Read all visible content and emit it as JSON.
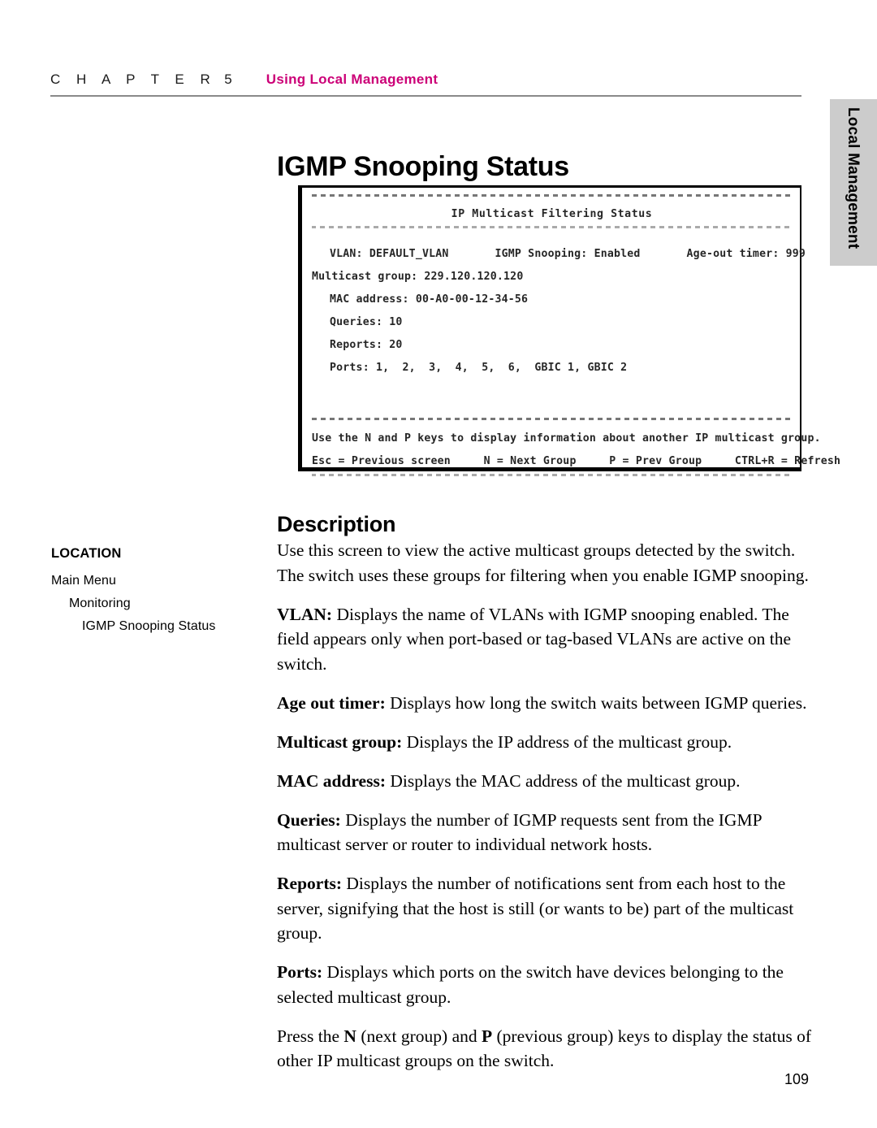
{
  "header": {
    "chapter_word": "C H A P T E R",
    "chapter_number": "5",
    "chapter_title": "Using Local Management",
    "accent_color": "#cc0077"
  },
  "side_tab": {
    "label": "Local Management",
    "background_color": "#cccccc"
  },
  "page_title": "IGMP Snooping Status",
  "terminal": {
    "title": "IP Multicast Filtering Status",
    "lines": [
      "VLAN: DEFAULT_VLAN       IGMP Snooping: Enabled       Age-out timer: 999",
      "Multicast group: 229.120.120.120",
      "MAC address: 00-A0-00-12-34-56",
      "Queries: 10",
      "Reports: 20",
      "Ports: 1,  2,  3,  4,  5,  6,  GBIC 1, GBIC 2"
    ],
    "help_line": "Use the N and P keys to display information about another IP multicast group.",
    "key_line": "Esc = Previous screen     N = Next Group     P = Prev Group     CTRL+R = Refresh",
    "fields": {
      "vlan_label": "VLAN:",
      "vlan_value": "DEFAULT_VLAN",
      "igmp_snooping_label": "IGMP Snooping:",
      "igmp_snooping_value": "Enabled",
      "age_out_timer_label": "Age-out timer:",
      "age_out_timer_value": "999",
      "multicast_group_label": "Multicast group:",
      "multicast_group_value": "229.120.120.120",
      "mac_address_label": "MAC address:",
      "mac_address_value": "00-A0-00-12-34-56",
      "queries_label": "Queries:",
      "queries_value": "10",
      "reports_label": "Reports:",
      "reports_value": "20",
      "ports_label": "Ports:",
      "ports_value": "1,  2,  3,  4,  5,  6,  GBIC 1, GBIC 2"
    },
    "keys": [
      {
        "key": "Esc",
        "action": "Previous screen"
      },
      {
        "key": "N",
        "action": "Next Group"
      },
      {
        "key": "P",
        "action": "Prev Group"
      },
      {
        "key": "CTRL+R",
        "action": "Refresh"
      }
    ]
  },
  "description_heading": "Description",
  "location": {
    "title": "LOCATION",
    "items": [
      {
        "label": "Main Menu",
        "level": 0
      },
      {
        "label": "Monitoring",
        "level": 1
      },
      {
        "label": "IGMP Snooping Status",
        "level": 2
      }
    ]
  },
  "body": {
    "paragraphs": [
      {
        "lead": "",
        "text": "Use this screen to view the active multicast groups detected by the switch. The switch uses these groups for filtering when you enable IGMP snooping."
      },
      {
        "lead": "VLAN:",
        "text": " Displays the name of VLANs with IGMP snooping enabled. The field appears only when port-based or tag-based VLANs are active on the switch."
      },
      {
        "lead": "Age out timer:",
        "text": " Displays how long the switch waits between IGMP queries."
      },
      {
        "lead": "Multicast group:",
        "text": " Displays the IP address of the multicast group."
      },
      {
        "lead": "MAC address:",
        "text": " Displays the MAC address of the multicast group."
      },
      {
        "lead": "Queries:",
        "text": " Displays the number of IGMP requests sent from the IGMP multicast server or router to individual network hosts."
      },
      {
        "lead": "Reports:",
        "text": " Displays the number of notifications sent from each host to the server, signifying that the host is still (or wants to be) part of the multicast group."
      },
      {
        "lead": "Ports:",
        "text": " Displays which ports on the switch have devices belonging to the selected multicast group."
      }
    ],
    "final_paragraph": {
      "part1": "Press the ",
      "key1": "N",
      "part2": " (next group) and ",
      "key2": "P",
      "part3": " (previous group) keys to display the status of other IP multicast groups on the switch."
    }
  },
  "page_number": "109"
}
